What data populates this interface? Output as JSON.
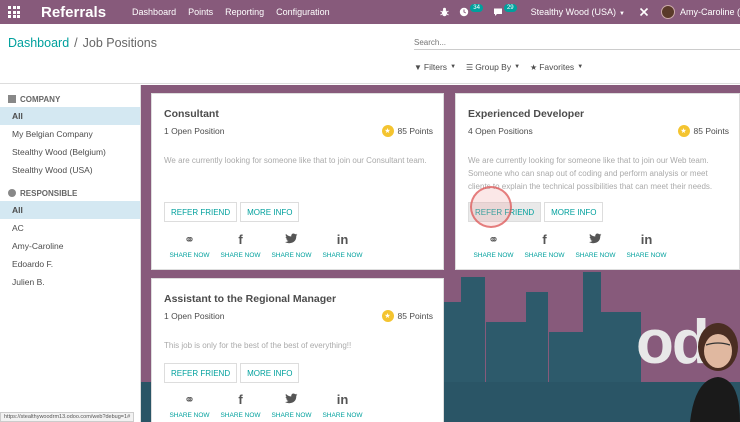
{
  "navbar": {
    "brand": "Referrals",
    "menu": [
      "Dashboard",
      "Points",
      "Reporting",
      "Configuration"
    ],
    "bug_icon": "bug-icon",
    "activity_badge": "34",
    "message_badge": "29",
    "company": "Stealthy Wood (USA)",
    "user": "Amy-Caroline ("
  },
  "breadcrumb": {
    "root": "Dashboard",
    "sep": "/",
    "current": "Job Positions"
  },
  "search": {
    "placeholder": "Search..."
  },
  "filters": {
    "filters": "Filters",
    "group_by": "Group By",
    "favorites": "Favorites"
  },
  "sidebar": {
    "company_header": "COMPANY",
    "company_items": [
      "All",
      "My Belgian Company",
      "Stealthy Wood (Belgium)",
      "Stealthy Wood (USA)"
    ],
    "responsible_header": "RESPONSIBLE",
    "responsible_items": [
      "All",
      "AC",
      "Amy-Caroline",
      "Edoardo F.",
      "Julien B."
    ]
  },
  "cards": [
    {
      "title": "Consultant",
      "open": "1 Open Position",
      "points": "85 Points",
      "desc": "We are currently looking for someone like that to join our Consultant team."
    },
    {
      "title": "Experienced Developer",
      "open": "4 Open Positions",
      "points": "85 Points",
      "desc": "We are currently looking for someone like that to join our Web team. Someone who can snap out of coding and perform analysis or meet clients to explain the technical possibilities that can meet their needs."
    },
    {
      "title": "Assistant to the Regional Manager",
      "open": "1 Open Position",
      "points": "85 Points",
      "desc": "This job is only for the best of the best of everything!!"
    }
  ],
  "buttons": {
    "refer": "REFER FRIEND",
    "more": "MORE INFO"
  },
  "share": {
    "label": "SHARE NOW",
    "facebook_glyph": "f",
    "linkedin_glyph": "in"
  },
  "brand_watermark": "od",
  "status_url": "https://stealthywoodrm13.odoo.com/web?debug=1#"
}
